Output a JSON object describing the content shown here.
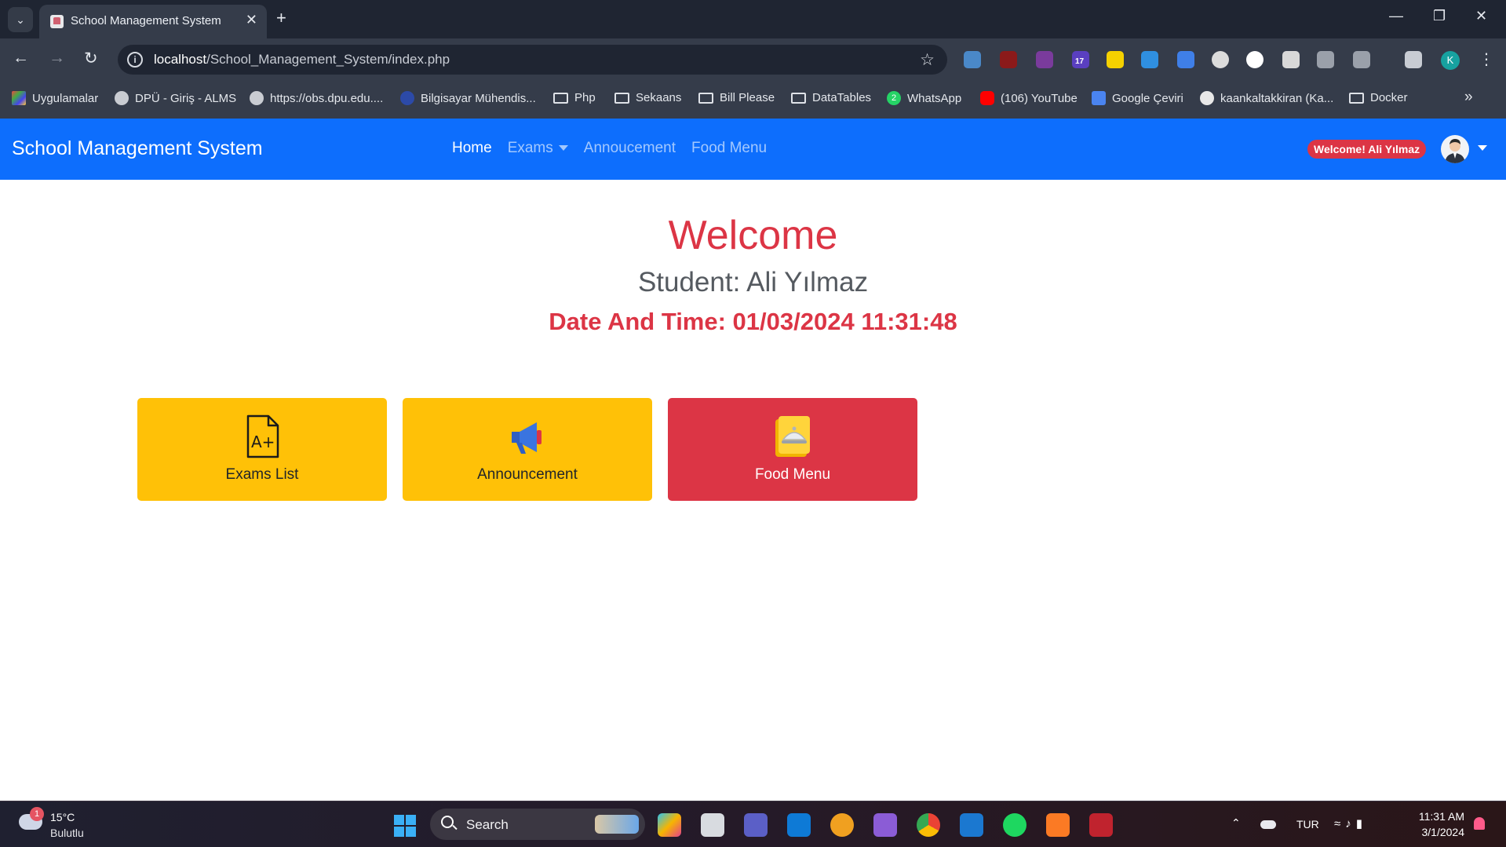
{
  "browser": {
    "tab_title": "School Management System",
    "url_host": "localhost",
    "url_path": "/School_Management_System/index.php",
    "profile_initial": "K",
    "extension_badge": "17"
  },
  "bookmarks": [
    {
      "label": "Uygulamalar",
      "icon": "apps-grid-icon"
    },
    {
      "label": "DPÜ - Giriş - ALMS",
      "icon": "globe-icon"
    },
    {
      "label": "https://obs.dpu.edu....",
      "icon": "globe-icon"
    },
    {
      "label": "Bilgisayar Mühendis...",
      "icon": "university-icon"
    },
    {
      "label": "Php",
      "icon": "folder-icon"
    },
    {
      "label": "Sekaans",
      "icon": "folder-icon"
    },
    {
      "label": "Bill Please",
      "icon": "folder-icon"
    },
    {
      "label": "DataTables",
      "icon": "folder-icon"
    },
    {
      "label": "WhatsApp",
      "icon": "whatsapp-icon",
      "badge": "2"
    },
    {
      "label": "(106) YouTube",
      "icon": "youtube-icon"
    },
    {
      "label": "Google Çeviri",
      "icon": "google-translate-icon"
    },
    {
      "label": "kaankaltakkiran (Ka...",
      "icon": "github-icon"
    },
    {
      "label": "Docker",
      "icon": "folder-icon"
    }
  ],
  "navbar": {
    "brand": "School Management System",
    "links": [
      {
        "label": "Home",
        "active": true
      },
      {
        "label": "Exams",
        "dropdown": true
      },
      {
        "label": "Annoucement"
      },
      {
        "label": "Food Menu"
      }
    ],
    "welcome_badge": "Welcome! Ali Yılmaz"
  },
  "hero": {
    "title": "Welcome",
    "student": "Student: Ali Yılmaz",
    "datetime": "Date And Time: 01/03/2024 11:31:48"
  },
  "cards": [
    {
      "label": "Exams List",
      "icon": "exam-grade-icon",
      "color": "#ffc107"
    },
    {
      "label": "Announcement",
      "icon": "megaphone-icon",
      "color": "#ffc107"
    },
    {
      "label": "Food Menu",
      "icon": "food-menu-icon",
      "color": "#dc3545"
    }
  ],
  "taskbar": {
    "weather_temp": "15°C",
    "weather_desc": "Bulutlu",
    "weather_badge": "1",
    "search_label": "Search",
    "language": "TUR",
    "time": "11:31 AM",
    "date": "3/1/2024"
  },
  "colors": {
    "primary": "#0d6efd",
    "danger": "#dc3545",
    "warning": "#ffc107"
  }
}
